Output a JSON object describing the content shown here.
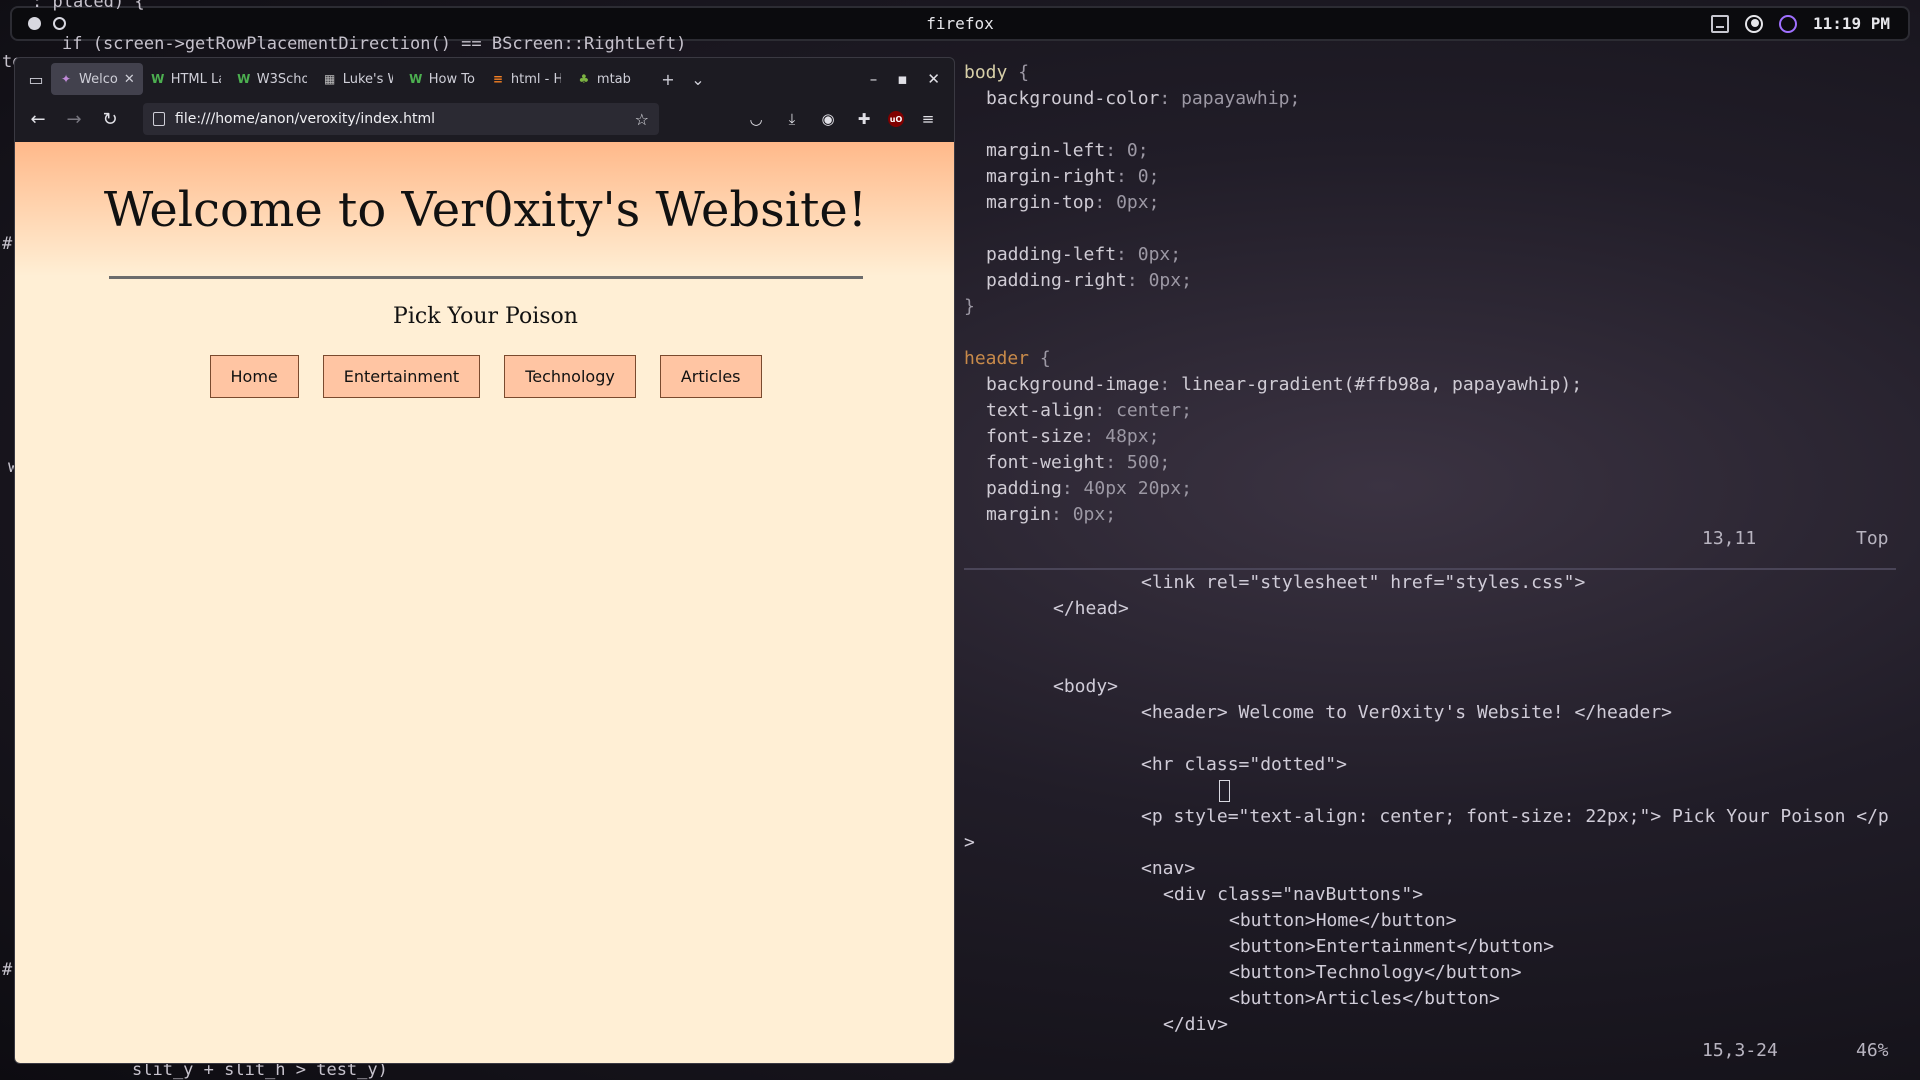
{
  "topbar": {
    "title": "firefox",
    "clock": "11:19 PM",
    "icons": [
      "window-monitor-icon",
      "night-mode-icon",
      "status-ring-icon"
    ]
  },
  "background_terminal": {
    "line_top_1": ": placed) {",
    "line_top_2": "if (screen->getRowPlacementDirection() == BScreen::RightLeft)",
    "fragment_left_1": "te",
    "fragment_left_2": "#",
    "fragment_left_3": "w",
    "fragment_left_4": "#",
    "line_bottom": "slit_y + slit_h > test_y)"
  },
  "firefox": {
    "tabs": [
      {
        "label": "Welco",
        "icon": "tab-welcome-favicon",
        "active": true
      },
      {
        "label": "HTML La",
        "icon": "w3schools-favicon",
        "active": false
      },
      {
        "label": "W3Scho",
        "icon": "w3schools-favicon",
        "active": false
      },
      {
        "label": "Luke's W",
        "icon": "lukes-favicon",
        "active": false
      },
      {
        "label": "How To",
        "icon": "w3schools-favicon",
        "active": false
      },
      {
        "label": "html - H",
        "icon": "stackoverflow-favicon",
        "active": false
      },
      {
        "label": "mtab",
        "icon": "palm-favicon",
        "active": false
      }
    ],
    "url": "file:///home/anon/veroxity/index.html"
  },
  "page": {
    "header": "Welcome to Ver0xity's Website!",
    "subtitle": "Pick Your Poison",
    "nav_buttons": [
      "Home",
      "Entertainment",
      "Technology",
      "Articles"
    ],
    "colors": {
      "gradient_top": "#ffb98a",
      "background": "papayawhip"
    }
  },
  "editor_css": {
    "lines": [
      {
        "a": "body",
        "b": " {"
      },
      {
        "p": "background-color",
        "v": "papayawhip;"
      },
      {
        "p": "",
        "v": ""
      },
      {
        "p": "margin-left",
        "v": "0;"
      },
      {
        "p": "margin-right",
        "v": "0;"
      },
      {
        "p": "margin-top",
        "v": "0px;"
      },
      {
        "p": "",
        "v": ""
      },
      {
        "p": "padding-left",
        "v": "0px;"
      },
      {
        "p": "padding-right",
        "v": "0px;"
      },
      {
        "a": "}",
        "b": ""
      },
      {
        "a": "",
        "b": ""
      },
      {
        "a": "header",
        "b": " {"
      },
      {
        "p": "background-image",
        "v": "linear-gradient(#ffb98a, papayawhip);"
      },
      {
        "p": "text-align",
        "v": "center;"
      },
      {
        "p": "font-size",
        "v": "48px;"
      },
      {
        "p": "font-weight",
        "v": "500;"
      },
      {
        "p": "padding",
        "v": "40px 20px;"
      },
      {
        "p": "margin",
        "v": "0px;"
      }
    ],
    "status_pos": "13,11",
    "status_scroll": "Top"
  },
  "editor_html": {
    "link_line": "<link rel=\"stylesheet\" href=\"styles.css\">",
    "head_close": "</head>",
    "body_open": "<body>",
    "header_line": "<header> Welcome to Ver0xity's Website! </header>",
    "hr_line": "<hr class=\"dotted\">",
    "p_line": "<p style=\"text-align: center; font-size: 22px;\"> Pick Your Poison </p",
    "p_wrap": ">",
    "nav_open": "<nav>",
    "div_open": "<div class=\"navButtons\">",
    "btn_home": "<button>Home</button>",
    "btn_ent": "<button>Entertainment</button>",
    "btn_tech": "<button>Technology</button>",
    "btn_art": "<button>Articles</button>",
    "div_close": "</div>",
    "status_pos": "15,3-24",
    "status_pct": "46%"
  }
}
